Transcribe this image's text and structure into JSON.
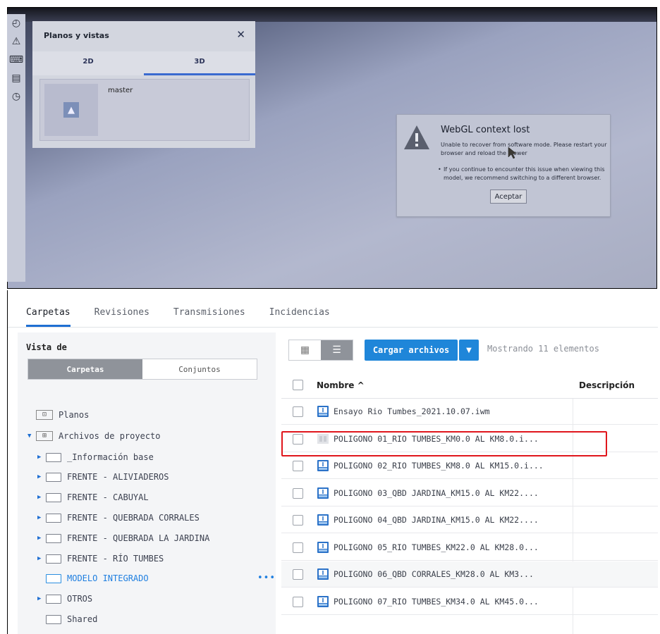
{
  "viewer": {
    "panel": {
      "title": "Planos y vistas",
      "close_glyph": "✕",
      "tabs": [
        {
          "label": "2D",
          "active": false
        },
        {
          "label": "3D",
          "active": true
        }
      ],
      "item_label": "master"
    },
    "rail_icons": [
      "gauge-icon",
      "warning-icon",
      "keyboard-icon",
      "document-icon",
      "clock-icon"
    ],
    "dialog": {
      "title": "WebGL context lost",
      "message": "Unable to recover from software mode. Please restart your browser and reload the Viewer",
      "bullet": "If you continue to encounter this issue when viewing this model, we recommend switching to a different browser.",
      "button": "Aceptar"
    }
  },
  "app": {
    "tabs": [
      {
        "label": "Carpetas",
        "active": true
      },
      {
        "label": "Revisiones",
        "active": false
      },
      {
        "label": "Transmisiones",
        "active": false
      },
      {
        "label": "Incidencias",
        "active": false
      }
    ],
    "sidebar": {
      "title": "Vista de",
      "segments": [
        {
          "label": "Carpetas",
          "active": true
        },
        {
          "label": "Conjuntos",
          "active": false
        }
      ],
      "tree": [
        {
          "label": "Planos",
          "icon": "sheet-icon",
          "level": 0,
          "caret": false
        },
        {
          "label": "Archivos de proyecto",
          "icon": "project-files-icon",
          "level": 0,
          "caret": true
        },
        {
          "label": "_Información base",
          "icon": "folder-icon",
          "level": 1,
          "caret": true
        },
        {
          "label": "FRENTE - ALIVIADEROS",
          "icon": "folder-icon",
          "level": 1,
          "caret": true
        },
        {
          "label": "FRENTE - CABUYAL",
          "icon": "folder-icon",
          "level": 1,
          "caret": true
        },
        {
          "label": "FRENTE - QUEBRADA CORRALES",
          "icon": "folder-icon",
          "level": 1,
          "caret": true
        },
        {
          "label": "FRENTE - QUEBRADA LA JARDINA",
          "icon": "folder-icon",
          "level": 1,
          "caret": true
        },
        {
          "label": "FRENTE - RÍO TUMBES",
          "icon": "folder-icon",
          "level": 1,
          "caret": true
        },
        {
          "label": "MODELO INTEGRADO",
          "icon": "folder-icon",
          "level": 1,
          "caret": false,
          "selected": true
        },
        {
          "label": "OTROS",
          "icon": "folder-icon",
          "level": 1,
          "caret": true
        },
        {
          "label": "Shared",
          "icon": "folder-icon",
          "level": 1,
          "caret": false
        }
      ],
      "more_glyph": "•••"
    },
    "toolbar": {
      "upload_label": "Cargar archivos",
      "showing_text": "Mostrando 11 elementos"
    },
    "table": {
      "headers": {
        "name": "Nombre ^",
        "description": "Descripción"
      },
      "rows": [
        {
          "name": "Ensayo Rio Tumbes_2021.10.07.iwm",
          "icon": "model-file-icon",
          "highlighted": false
        },
        {
          "name": "POLIGONO 01_RIO TUMBES_KM0.0 AL KM8.0.i...",
          "icon": "unprocessed-file-icon",
          "highlighted": true
        },
        {
          "name": "POLIGONO 02_RIO TUMBES_KM8.0 AL KM15.0.i...",
          "icon": "model-file-icon",
          "highlighted": false
        },
        {
          "name": "POLIGONO 03_QBD JARDINA_KM15.0 AL KM22....",
          "icon": "model-file-icon",
          "highlighted": false
        },
        {
          "name": "POLIGONO 04_QBD JARDINA_KM15.0 AL KM22....",
          "icon": "model-file-icon",
          "highlighted": false
        },
        {
          "name": "POLIGONO 05_RIO TUMBES_KM22.0 AL KM28.0...",
          "icon": "model-file-icon",
          "highlighted": false
        },
        {
          "name": "POLIGONO 06_QBD CORRALES_KM28.0 AL KM3...",
          "icon": "model-file-icon",
          "highlighted": false
        },
        {
          "name": "POLIGONO 07_RIO TUMBES_KM34.0 AL KM45.0...",
          "icon": "model-file-icon",
          "highlighted": false
        }
      ]
    },
    "colors": {
      "accent": "#1f86d9",
      "highlight": "#e0161c"
    }
  }
}
